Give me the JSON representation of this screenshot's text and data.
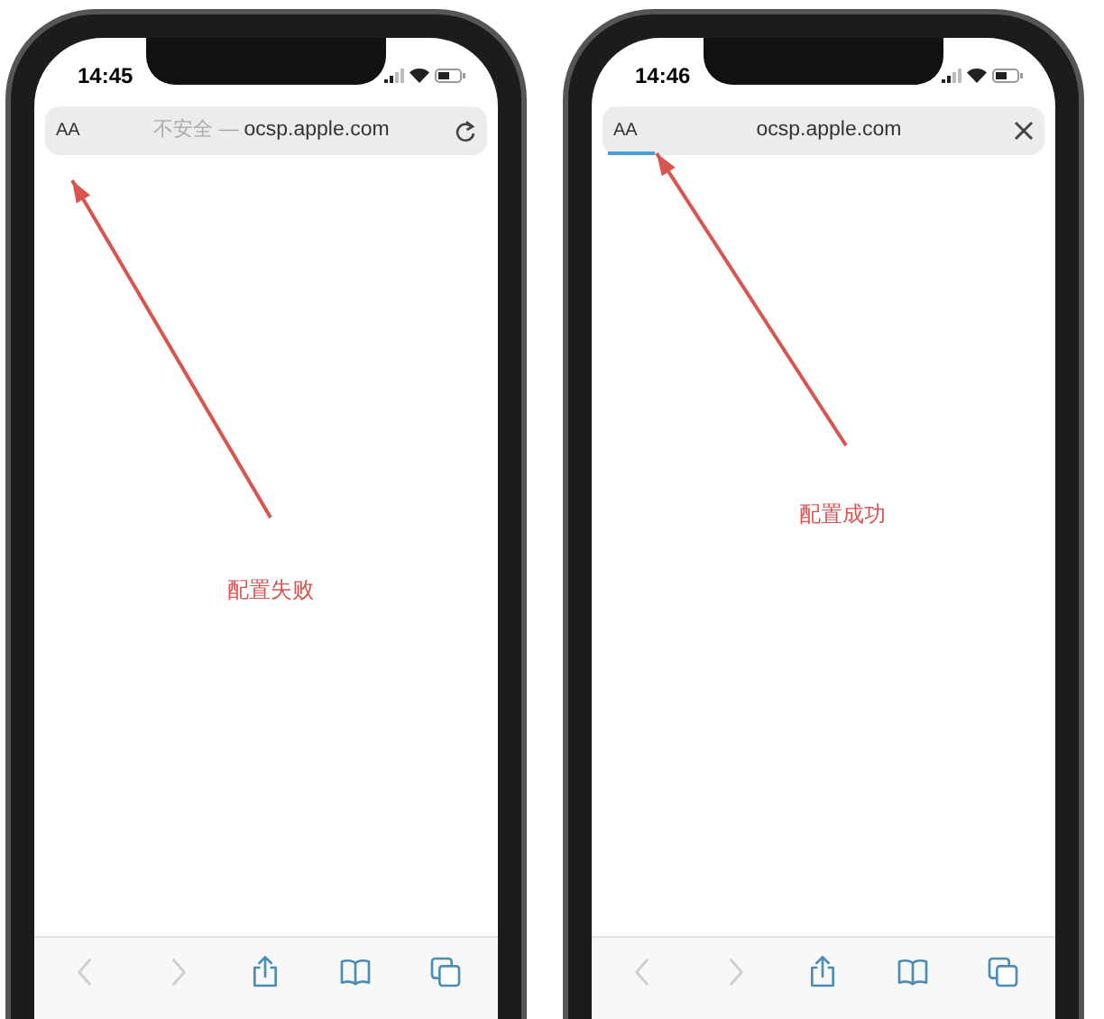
{
  "phones": [
    {
      "time": "14:45",
      "address_bar": {
        "text_size_button": "AA",
        "security_note": "不安全 —",
        "url": "ocsp.apple.com",
        "trailing_button": {
          "kind": "reload"
        },
        "loading": false
      },
      "annotation": "配置失败",
      "toolbar": [
        {
          "kind": "back",
          "disabled": true
        },
        {
          "kind": "forward",
          "disabled": true
        },
        {
          "kind": "share",
          "disabled": false
        },
        {
          "kind": "bookmarks",
          "disabled": false
        },
        {
          "kind": "tabs",
          "disabled": false
        }
      ]
    },
    {
      "time": "14:46",
      "address_bar": {
        "text_size_button": "AA",
        "url": "ocsp.apple.com",
        "trailing_button": {
          "kind": "close"
        },
        "loading": true
      },
      "annotation": "配置成功",
      "toolbar": [
        {
          "kind": "back",
          "disabled": true
        },
        {
          "kind": "forward",
          "disabled": true
        },
        {
          "kind": "share",
          "disabled": false
        },
        {
          "kind": "bookmarks",
          "disabled": false
        },
        {
          "kind": "tabs",
          "disabled": false
        }
      ]
    }
  ]
}
